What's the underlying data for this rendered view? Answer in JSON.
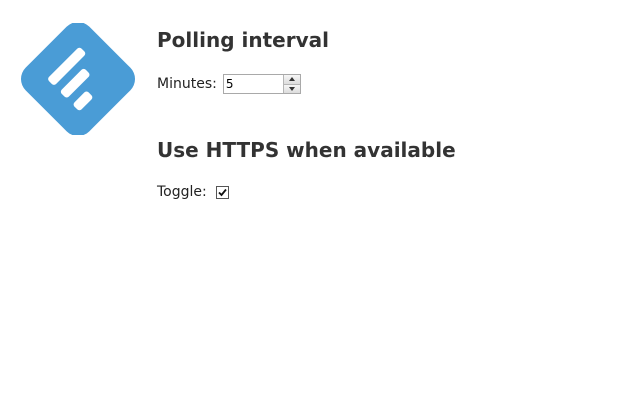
{
  "logo": {
    "icon": "feedly-logo-icon",
    "color": "#4a9cd6"
  },
  "polling": {
    "title": "Polling interval",
    "label": "Minutes:",
    "value": "5"
  },
  "https": {
    "title": "Use HTTPS when available",
    "label": "Toggle:",
    "checked": true
  }
}
